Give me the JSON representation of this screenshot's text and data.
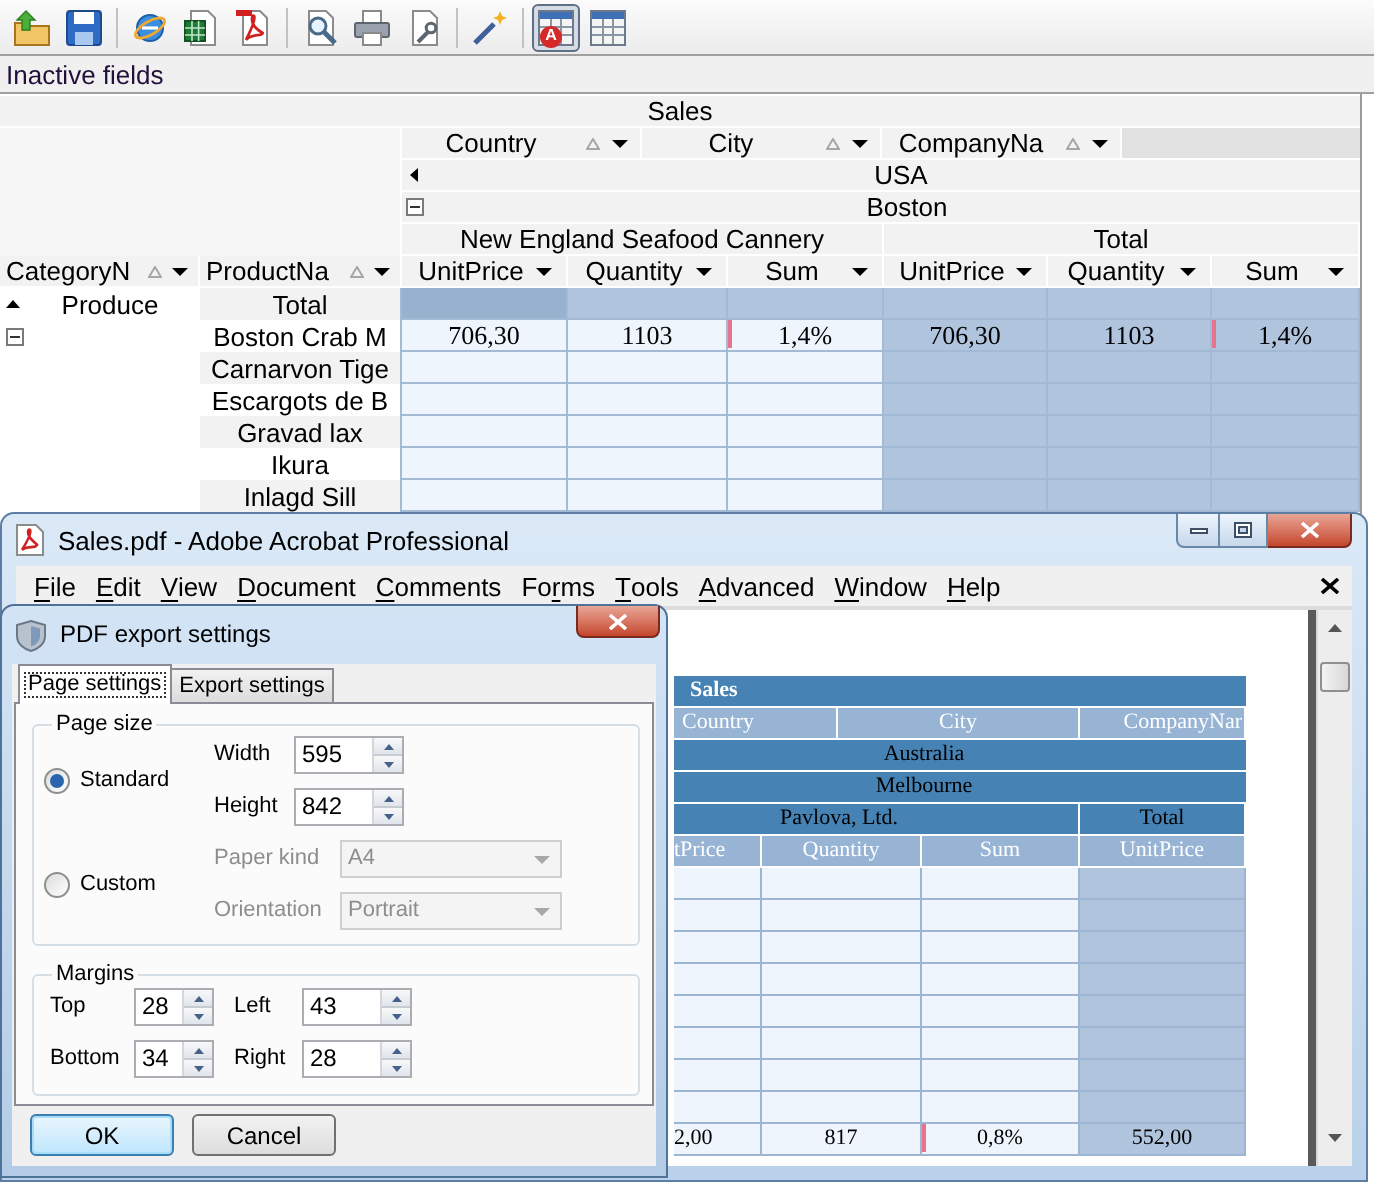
{
  "toolbar": {
    "groups": [
      {
        "buttons": [
          {
            "kind": "open",
            "pressed": false
          },
          {
            "kind": "save",
            "pressed": false
          }
        ]
      },
      {
        "buttons": [
          {
            "kind": "html",
            "pressed": false
          },
          {
            "kind": "excel",
            "pressed": false
          },
          {
            "kind": "pdf",
            "pressed": false
          }
        ]
      },
      {
        "buttons": [
          {
            "kind": "preview",
            "pressed": false
          },
          {
            "kind": "print",
            "pressed": false
          },
          {
            "kind": "page_setup",
            "pressed": false
          }
        ]
      },
      {
        "buttons": [
          {
            "kind": "wizard",
            "pressed": false
          }
        ]
      },
      {
        "buttons": [
          {
            "kind": "table",
            "badge": "A",
            "pressed": true
          },
          {
            "kind": "table",
            "pressed": false
          }
        ]
      }
    ]
  },
  "inactive_fields": {
    "label": "Inactive fields"
  },
  "pivot": {
    "title": "Sales",
    "column_fields": [
      {
        "label": "Country"
      },
      {
        "label": "City"
      },
      {
        "label": "CompanyNa"
      }
    ],
    "country": {
      "label": "USA"
    },
    "city": {
      "label": "Boston",
      "expanded": true
    },
    "column_groups": [
      {
        "label": "New England Seafood Cannery",
        "kind": "company",
        "measures": [
          {
            "label": "UnitPrice",
            "kind": "number"
          },
          {
            "label": "Quantity",
            "kind": "number"
          },
          {
            "label": "Sum",
            "kind": "percent"
          }
        ]
      },
      {
        "label": "Total",
        "kind": "total",
        "measures": [
          {
            "label": "UnitPrice",
            "kind": "number"
          },
          {
            "label": "Quantity",
            "kind": "number"
          },
          {
            "label": "Sum",
            "kind": "percent"
          }
        ]
      }
    ],
    "row_fields": [
      {
        "label": "CategoryN"
      },
      {
        "label": "ProductNa"
      }
    ],
    "row_groups": [
      {
        "label": "Produce",
        "expanded": true,
        "rows": [
          {
            "label": "Total",
            "kind": "total",
            "cells": [
              {
                "selected": true
              },
              {
                "selected": false
              },
              {
                "selected": false
              },
              {
                "selected": false
              },
              {
                "selected": false
              },
              {
                "selected": false
              }
            ]
          },
          {
            "label": "Boston Crab M",
            "kind": "item",
            "cells": [
              {
                "value": "706,30",
                "selected": false
              },
              {
                "value": "1103",
                "selected": false
              },
              {
                "value": "1,4%",
                "selected": false
              },
              {
                "value": "706,30",
                "selected": false
              },
              {
                "value": "1103",
                "selected": false
              },
              {
                "value": "1,4%",
                "selected": false
              }
            ]
          },
          {
            "label": "Carnarvon Tige",
            "kind": "item",
            "cells": [
              {
                "selected": false
              },
              {
                "selected": false
              },
              {
                "selected": false
              },
              {
                "selected": false
              },
              {
                "selected": false
              },
              {
                "selected": false
              }
            ]
          },
          {
            "label": "Escargots de B",
            "kind": "item",
            "cells": [
              {
                "selected": false
              },
              {
                "selected": false
              },
              {
                "selected": false
              },
              {
                "selected": false
              },
              {
                "selected": false
              },
              {
                "selected": false
              }
            ]
          },
          {
            "label": "Gravad lax",
            "kind": "item",
            "cells": [
              {
                "selected": false
              },
              {
                "selected": false
              },
              {
                "selected": false
              },
              {
                "selected": false
              },
              {
                "selected": false
              },
              {
                "selected": false
              }
            ]
          },
          {
            "label": "Ikura",
            "kind": "item",
            "cells": [
              {
                "selected": false
              },
              {
                "selected": false
              },
              {
                "selected": false
              },
              {
                "selected": false
              },
              {
                "selected": false
              },
              {
                "selected": false
              }
            ]
          },
          {
            "label": "Inlagd Sill",
            "kind": "item",
            "cells": [
              {
                "selected": false
              },
              {
                "selected": false
              },
              {
                "selected": false
              },
              {
                "selected": false
              },
              {
                "selected": false
              },
              {
                "selected": false
              }
            ]
          }
        ]
      }
    ]
  },
  "acrobat": {
    "title": "Sales.pdf - Adobe Acrobat Professional",
    "menu": [
      {
        "key": "F",
        "rest": "ile"
      },
      {
        "key": "E",
        "rest": "dit"
      },
      {
        "key": "V",
        "rest": "iew"
      },
      {
        "key": "D",
        "rest": "ocument"
      },
      {
        "key": "C",
        "rest": "omments"
      },
      {
        "lead": "Fo",
        "key": "r",
        "rest": "ms"
      },
      {
        "key": "T",
        "rest": "ools"
      },
      {
        "key": "A",
        "rest": "dvanced"
      },
      {
        "key": "W",
        "rest": "indow"
      },
      {
        "key": "H",
        "rest": "elp"
      }
    ],
    "pdf_page": {
      "title": "Sales",
      "column_fields": [
        {
          "label": "Country"
        },
        {
          "label": "City"
        },
        {
          "label": "CompanyNar"
        }
      ],
      "country": "Australia",
      "city": "Melbourne",
      "column_groups": [
        {
          "label": "Pavlova, Ltd.",
          "kind": "company",
          "measures": [
            {
              "label": "tPrice",
              "kind": "number"
            },
            {
              "label": "Quantity",
              "kind": "number"
            },
            {
              "label": "Sum",
              "kind": "percent"
            }
          ]
        },
        {
          "label": "Total",
          "kind": "total",
          "measures": [
            {
              "label": "UnitPrice",
              "kind": "number"
            }
          ]
        }
      ],
      "rows": [
        {
          "cells": [
            "2,00",
            "817",
            "0,8%",
            "552,00"
          ]
        }
      ]
    }
  },
  "dialog": {
    "title": "PDF export settings",
    "tabs": [
      {
        "label": "Page settings",
        "selected": true
      },
      {
        "label": "Export settings",
        "selected": false
      }
    ],
    "page_size": {
      "title": "Page size",
      "options": [
        {
          "label": "Standard",
          "selected": true
        },
        {
          "label": "Custom",
          "selected": false
        }
      ],
      "width": {
        "label": "Width",
        "value": "595"
      },
      "height": {
        "label": "Height",
        "value": "842"
      },
      "paper_kind": {
        "label": "Paper kind",
        "value": "A4",
        "disabled": true
      },
      "orientation": {
        "label": "Orientation",
        "value": "Portrait",
        "disabled": true
      }
    },
    "margins": {
      "title": "Margins",
      "fields": [
        {
          "label": "Top",
          "value": "28"
        },
        {
          "label": "Left",
          "value": "43"
        },
        {
          "label": "Bottom",
          "value": "34"
        },
        {
          "label": "Right",
          "value": "28"
        }
      ]
    },
    "buttons": [
      {
        "label": "OK",
        "default": true
      },
      {
        "label": "Cancel",
        "default": false
      }
    ]
  }
}
